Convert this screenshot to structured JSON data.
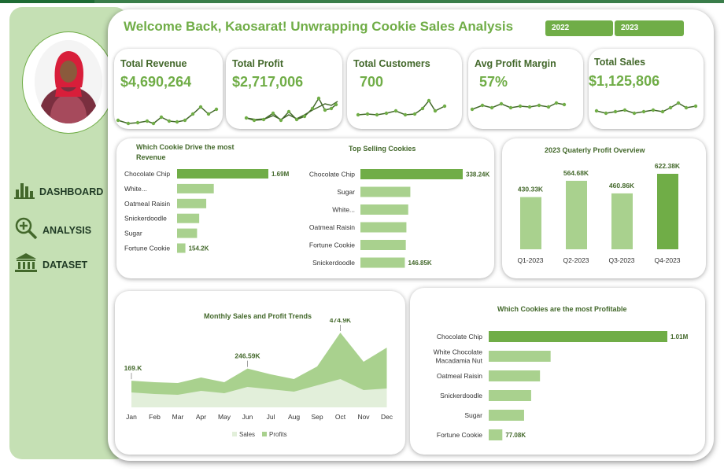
{
  "header": {
    "title": "Welcome Back, Kaosarat! Unwrapping Cookie Sales Analysis",
    "years": [
      "2022",
      "2023"
    ]
  },
  "sidebar": {
    "items": [
      {
        "label": "DASHBOARD",
        "icon": "bar-chart-icon"
      },
      {
        "label": "ANALYSIS",
        "icon": "magnifier-plus-icon"
      },
      {
        "label": "DATASET",
        "icon": "bank-building-icon"
      }
    ]
  },
  "kpis": [
    {
      "label": "Total Revenue",
      "value": "$4,690,264"
    },
    {
      "label": "Total Profit",
      "value": "$2,717,006"
    },
    {
      "label": "Total Customers",
      "value": "700"
    },
    {
      "label": "Avg Profit Margin",
      "value": "57%"
    },
    {
      "label": "Total Sales",
      "value": "$1,125,806"
    }
  ],
  "colors": {
    "accent": "#70ad47",
    "light": "#a9d18e",
    "pale": "#e2efda",
    "text": "#43682b"
  },
  "chart_data": [
    {
      "type": "bar",
      "orientation": "horizontal",
      "title": "Which Cookie Drive the most Revenue",
      "categories": [
        "Chocolate Chip",
        "White...",
        "Oatmeal Raisin",
        "Snickerdoodle",
        "Sugar",
        "Fortune Cookie"
      ],
      "values": [
        1690000,
        680000,
        540000,
        410000,
        370000,
        154200
      ],
      "data_labels": [
        "1.69M",
        "",
        "",
        "",
        "",
        "154.2K"
      ]
    },
    {
      "type": "bar",
      "orientation": "horizontal",
      "title": "Top Selling Cookies",
      "categories": [
        "Chocolate Chip",
        "Sugar",
        "White...",
        "Oatmeal Raisin",
        "Fortune Cookie",
        "Snickerdoodle"
      ],
      "values": [
        338240,
        165000,
        158000,
        152000,
        150000,
        146850
      ],
      "data_labels": [
        "338.24K",
        "",
        "",
        "",
        "",
        "146.85K"
      ]
    },
    {
      "type": "bar",
      "title": "2023 Quaterly Profit Overview",
      "categories": [
        "Q1-2023",
        "Q2-2023",
        "Q3-2023",
        "Q4-2023"
      ],
      "values": [
        430330,
        564680,
        460860,
        622380
      ],
      "data_labels": [
        "430.33K",
        "564.68K",
        "460.86K",
        "622.38K"
      ]
    },
    {
      "type": "area",
      "title": "Monthly Sales and Profit Trends",
      "categories": [
        "Jan",
        "Feb",
        "Mar",
        "Apr",
        "May",
        "Jun",
        "Jul",
        "Aug",
        "Sep",
        "Oct",
        "Nov",
        "Dec"
      ],
      "series": [
        {
          "name": "Sales",
          "values": [
            169600,
            160000,
            155000,
            190000,
            160000,
            246590,
            210000,
            180000,
            260000,
            474900,
            290000,
            380000
          ]
        },
        {
          "name": "Profits",
          "values": [
            95000,
            85000,
            80000,
            105000,
            90000,
            130000,
            115000,
            100000,
            140000,
            180000,
            110000,
            120000
          ]
        }
      ],
      "data_labels": [
        "169.K",
        "246.59K",
        "474.9K"
      ],
      "legend": "bottom"
    },
    {
      "type": "bar",
      "orientation": "horizontal",
      "title": "Which Cookies are the most Profitable",
      "categories": [
        "Chocolate Chip",
        "White Chocolate Macadamia Nut",
        "Oatmeal Raisin",
        "Snickerdoodle",
        "Sugar",
        "Fortune Cookie"
      ],
      "values": [
        1010000,
        350000,
        290000,
        240000,
        200000,
        77080
      ],
      "data_labels": [
        "1.01M",
        "",
        "",
        "",
        "",
        "77.08K"
      ]
    }
  ]
}
